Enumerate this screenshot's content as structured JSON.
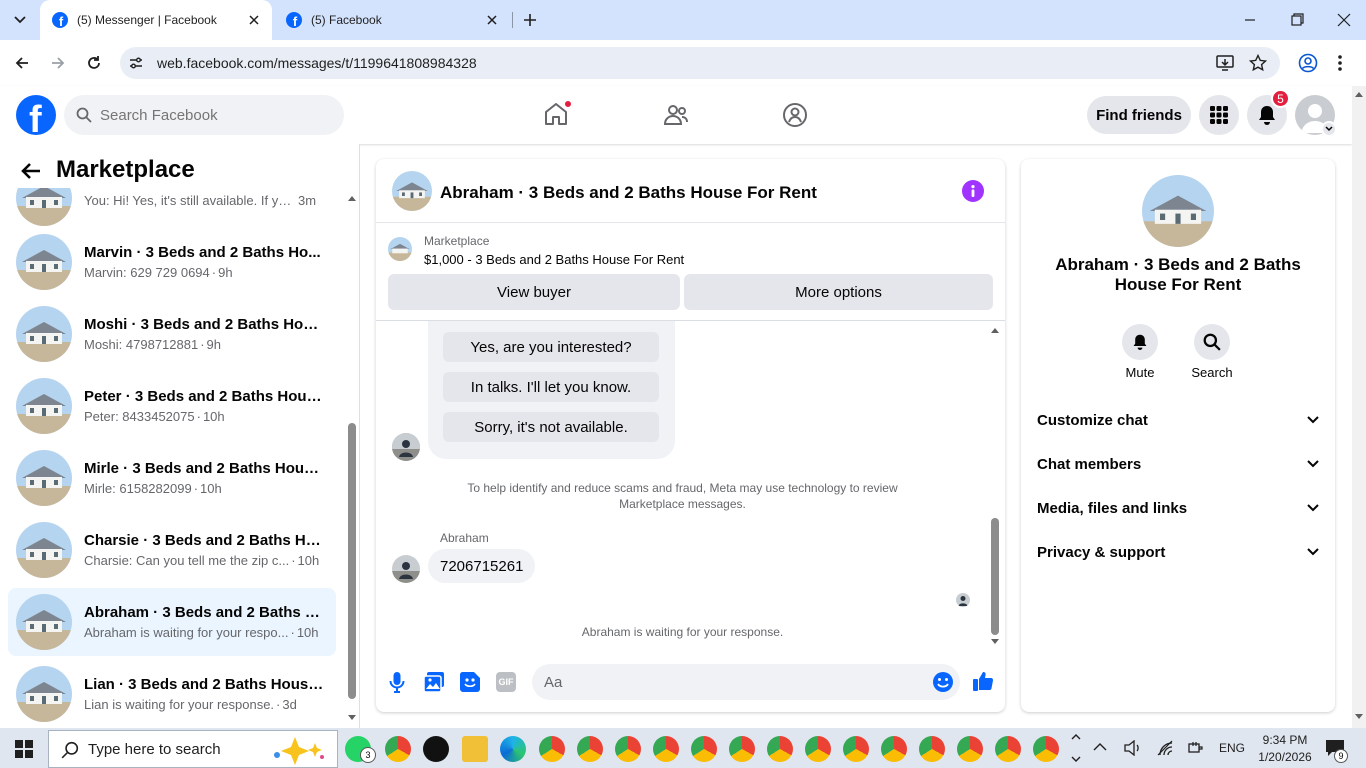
{
  "browser": {
    "tabs": [
      {
        "title": "(5) Messenger | Facebook",
        "active": true
      },
      {
        "title": "(5) Facebook",
        "active": false
      }
    ],
    "url": "web.facebook.com/messages/t/1199641808984328"
  },
  "facebook": {
    "search_placeholder": "Search Facebook",
    "find_friends": "Find friends",
    "notification_count": "5"
  },
  "sidebar": {
    "title": "Marketplace",
    "threads": [
      {
        "name": "",
        "preview": "You: Hi! Yes, it's still available. If yo...",
        "time": "3m"
      },
      {
        "name": "Marvin · 3 Beds and 2 Baths Ho...",
        "preview": "Marvin: 629 729 0694",
        "time": "9h"
      },
      {
        "name": "Moshi · 3 Beds and 2 Baths Hou...",
        "preview": "Moshi: 4798712881",
        "time": "9h"
      },
      {
        "name": "Peter · 3 Beds and 2 Baths Hous...",
        "preview": "Peter: 8433452075",
        "time": "10h"
      },
      {
        "name": "Mirle · 3 Beds and 2 Baths Hous...",
        "preview": "Mirle: 6158282099",
        "time": "10h"
      },
      {
        "name": "Charsie · 3 Beds and 2 Baths Ho...",
        "preview": "Charsie: Can you tell me the zip c...",
        "time": "10h"
      },
      {
        "name": "Abraham · 3 Beds and 2 Baths H...",
        "preview": "Abraham is waiting for your respo...",
        "time": "10h"
      },
      {
        "name": "Lian · 3 Beds and 2 Baths House ...",
        "preview": "Lian is waiting for your response.",
        "time": "3d"
      }
    ]
  },
  "chat": {
    "title": "Abraham · 3 Beds and 2 Baths House For Rent",
    "listing_label": "Marketplace",
    "listing_detail": "$1,000 - 3 Beds and 2 Baths House For Rent",
    "view_buyer": "View buyer",
    "more_options": "More options",
    "quick_replies": [
      "Yes, are you interested?",
      "In talks. I'll let you know.",
      "Sorry, it's not available."
    ],
    "notice": "To help identify and reduce scams and fraud, Meta may use technology to review Marketplace messages.",
    "sender": "Abraham",
    "message": "7206715261",
    "waiting": "Abraham is waiting for your response.",
    "composer_placeholder": "Aa",
    "gif_label": "GIF"
  },
  "details": {
    "name": "Abraham · 3 Beds and 2 Baths House For Rent",
    "mute": "Mute",
    "search": "Search",
    "sections": [
      "Customize chat",
      "Chat members",
      "Media, files and links",
      "Privacy & support"
    ]
  },
  "taskbar": {
    "search_placeholder": "Type here to search",
    "whatsapp_badge": "3",
    "lang": "ENG",
    "time": "9:34 PM",
    "date": "1/20/2026",
    "notif_badge": "9"
  },
  "colors": {
    "fb_blue": "#0866ff",
    "purple": "#a033ff",
    "badge_red": "#e41e3f"
  }
}
